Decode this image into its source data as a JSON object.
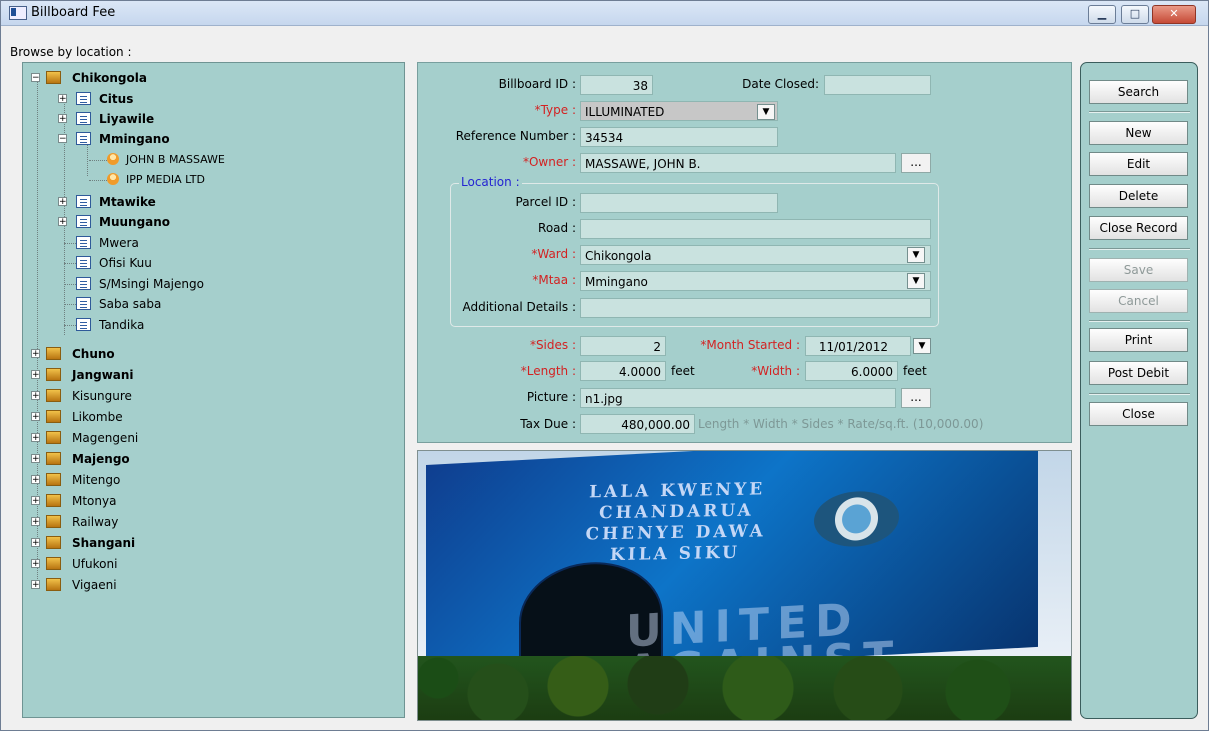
{
  "window": {
    "title": "Billboard Fee",
    "controls": [
      "minimize",
      "maximize",
      "close"
    ]
  },
  "browse_label": "Browse by location :",
  "tree": [
    {
      "label": "Chikongola",
      "level": 0,
      "expanded": true,
      "bold": true,
      "icon": "folder-icon"
    },
    {
      "label": "Citus",
      "level": 1,
      "expanded": false,
      "bold": true,
      "icon": "document-icon"
    },
    {
      "label": "Liyawile",
      "level": 1,
      "expanded": false,
      "bold": true,
      "icon": "document-icon"
    },
    {
      "label": "Mmingano",
      "level": 1,
      "expanded": true,
      "bold": true,
      "icon": "document-icon"
    },
    {
      "label": "JOHN B MASSAWE",
      "level": 2,
      "expanded": false,
      "bold": false,
      "icon": "user-icon"
    },
    {
      "label": "IPP MEDIA LTD",
      "level": 2,
      "expanded": false,
      "bold": false,
      "icon": "user-icon"
    },
    {
      "label": "Mtawike",
      "level": 1,
      "expanded": false,
      "bold": true,
      "icon": "document-icon"
    },
    {
      "label": "Muungano",
      "level": 1,
      "expanded": false,
      "bold": true,
      "icon": "document-icon"
    },
    {
      "label": "Mwera",
      "level": 1,
      "expanded": false,
      "bold": false,
      "icon": "document-icon"
    },
    {
      "label": "Ofisi Kuu",
      "level": 1,
      "expanded": false,
      "bold": false,
      "icon": "document-icon"
    },
    {
      "label": "S/Msingi Majengo",
      "level": 1,
      "expanded": false,
      "bold": false,
      "icon": "document-icon"
    },
    {
      "label": "Saba saba",
      "level": 1,
      "expanded": false,
      "bold": false,
      "icon": "document-icon"
    },
    {
      "label": "Tandika",
      "level": 1,
      "expanded": false,
      "bold": false,
      "icon": "document-icon"
    },
    {
      "label": "Chuno",
      "level": 0,
      "expanded": false,
      "bold": true,
      "icon": "folder-icon"
    },
    {
      "label": "Jangwani",
      "level": 0,
      "expanded": false,
      "bold": true,
      "icon": "folder-icon"
    },
    {
      "label": "Kisungure",
      "level": 0,
      "expanded": false,
      "bold": false,
      "icon": "folder-icon"
    },
    {
      "label": "Likombe",
      "level": 0,
      "expanded": false,
      "bold": false,
      "icon": "folder-icon"
    },
    {
      "label": "Magengeni",
      "level": 0,
      "expanded": false,
      "bold": false,
      "icon": "folder-icon"
    },
    {
      "label": "Majengo",
      "level": 0,
      "expanded": false,
      "bold": true,
      "icon": "folder-icon"
    },
    {
      "label": "Mitengo",
      "level": 0,
      "expanded": false,
      "bold": false,
      "icon": "folder-icon"
    },
    {
      "label": "Mtonya",
      "level": 0,
      "expanded": false,
      "bold": false,
      "icon": "folder-icon"
    },
    {
      "label": "Railway",
      "level": 0,
      "expanded": false,
      "bold": false,
      "icon": "folder-icon"
    },
    {
      "label": "Shangani",
      "level": 0,
      "expanded": false,
      "bold": true,
      "icon": "folder-icon"
    },
    {
      "label": "Ufukoni",
      "level": 0,
      "expanded": false,
      "bold": false,
      "icon": "folder-icon"
    },
    {
      "label": "Vigaeni",
      "level": 0,
      "expanded": false,
      "bold": false,
      "icon": "folder-icon"
    }
  ],
  "form": {
    "billboard_id": {
      "label": "Billboard ID :",
      "value": "38"
    },
    "date_closed": {
      "label": "Date Closed:",
      "value": ""
    },
    "type": {
      "label": "*Type :",
      "value": "ILLUMINATED"
    },
    "reference_number": {
      "label": "Reference Number :",
      "value": "34534"
    },
    "owner": {
      "label": "*Owner :",
      "value": "MASSAWE, JOHN B."
    },
    "location": {
      "title": "Location :",
      "parcel_id": {
        "label": "Parcel ID :",
        "value": ""
      },
      "road": {
        "label": "Road :",
        "value": ""
      },
      "ward": {
        "label": "*Ward :",
        "value": "Chikongola"
      },
      "mtaa": {
        "label": "*Mtaa :",
        "value": "Mmingano"
      },
      "additional_details": {
        "label": "Additional Details :",
        "value": ""
      }
    },
    "sides": {
      "label": "*Sides :",
      "value": "2"
    },
    "month_started": {
      "label": "*Month Started :",
      "value": "11/01/2012"
    },
    "length": {
      "label": "*Length :",
      "value": "4.0000",
      "unit": "feet"
    },
    "width": {
      "label": "*Width :",
      "value": "6.0000",
      "unit": "feet"
    },
    "picture": {
      "label": "Picture :",
      "value": "n1.jpg"
    },
    "tax_due": {
      "label": "Tax Due :",
      "value": "480,000.00",
      "formula": "Length * Width * Sides * Rate/sq.ft. (10,000.00)"
    },
    "browse_button": "..."
  },
  "billboard_photo": {
    "headline": [
      "LALA KWENYE",
      "CHANDARUA",
      "CHENYE DAWA",
      "KILA SIKU"
    ],
    "watermark": "UNITED AGAINST MALARIA"
  },
  "buttons": {
    "search": "Search",
    "new": "New",
    "edit": "Edit",
    "delete": "Delete",
    "close_record": "Close Record",
    "save": "Save",
    "cancel": "Cancel",
    "print": "Print",
    "post_debit": "Post Debit",
    "close": "Close"
  },
  "colors": {
    "panel": "#a5cfcc",
    "required_text": "#d32222",
    "location_text": "#2424d2"
  }
}
